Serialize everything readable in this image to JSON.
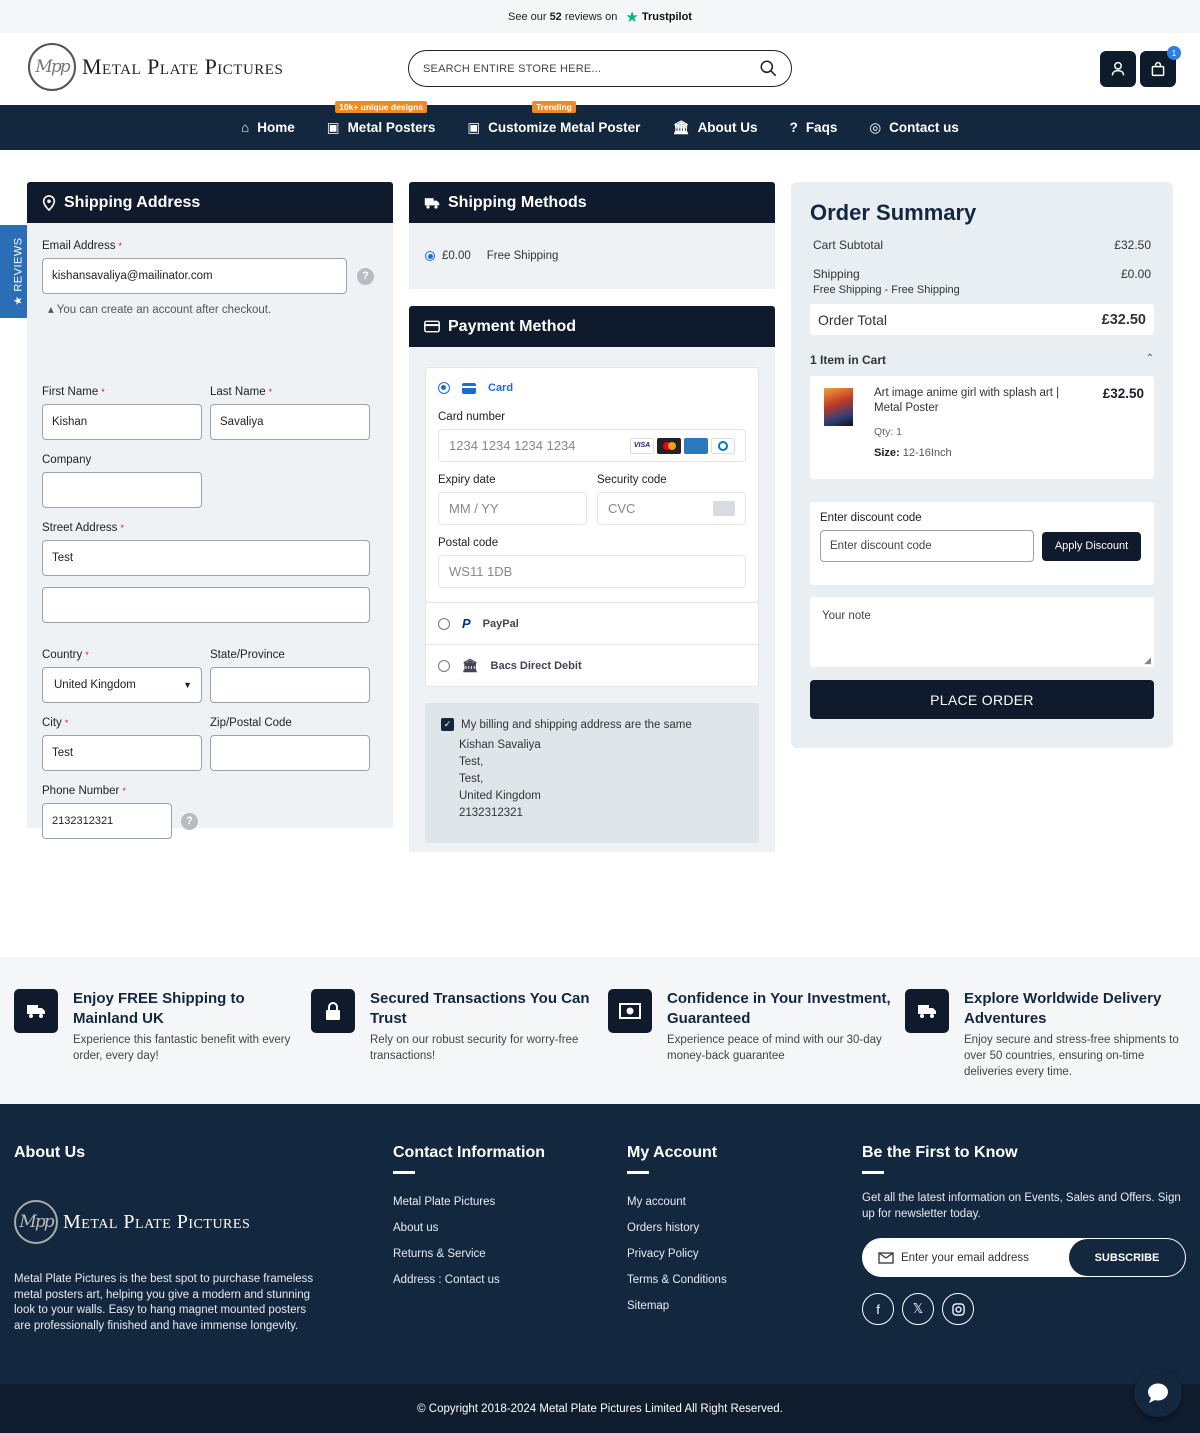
{
  "topbar": {
    "prefix": "See our",
    "count": "52",
    "suffix": "reviews on",
    "brand": "Trustpilot"
  },
  "header": {
    "logo_mark": "Mpp",
    "logo_text": "Metal Plate Pictures",
    "search_placeholder": "SEARCH ENTIRE STORE HERE...",
    "cart_count": "1"
  },
  "nav": [
    {
      "label": "Home",
      "icon": "home-icon"
    },
    {
      "label": "Metal Posters",
      "icon": "image-icon",
      "tag": "10k+ unique designs"
    },
    {
      "label": "Customize Metal Poster",
      "icon": "picture-icon",
      "tag": "Trending"
    },
    {
      "label": "About Us",
      "icon": "bank-icon"
    },
    {
      "label": "Faqs",
      "icon": "question-icon"
    },
    {
      "label": "Contact us",
      "icon": "lifebuoy-icon"
    }
  ],
  "reviews_tab": "★ REVIEWS",
  "shipping": {
    "title": "Shipping Address",
    "email_label": "Email Address",
    "email_value": "kishansavaliya@mailinator.com",
    "account_note": "You can create an account after checkout.",
    "first_name_label": "First Name",
    "first_name_value": "Kishan",
    "last_name_label": "Last Name",
    "last_name_value": "Savaliya",
    "company_label": "Company",
    "company_value": "",
    "street_label": "Street Address",
    "street_value": "Test",
    "street2_value": "",
    "country_label": "Country",
    "country_value": "United Kingdom",
    "state_label": "State/Province",
    "state_value": "",
    "city_label": "City",
    "city_value": "Test",
    "zip_label": "Zip/Postal Code",
    "zip_value": "",
    "phone_label": "Phone Number",
    "phone_value": "2132312321",
    "required_mark": "*"
  },
  "methods": {
    "title": "Shipping Methods",
    "price": "£0.00",
    "name": "Free Shipping"
  },
  "payment": {
    "title": "Payment Method",
    "card_label": "Card",
    "card_number_label": "Card number",
    "card_number_placeholder": "1234 1234 1234 1234",
    "visa_text": "VISA",
    "expiry_label": "Expiry date",
    "expiry_placeholder": "MM / YY",
    "cvc_label": "Security code",
    "cvc_placeholder": "CVC",
    "postal_label": "Postal code",
    "postal_value": "WS11 1DB",
    "paypal_label": "PayPal",
    "bacs_label": "Bacs Direct Debit",
    "billing_same_label": "My billing and shipping address are the same",
    "billing_lines": [
      "Kishan Savaliya",
      "Test,",
      "Test,",
      "United Kingdom",
      "2132312321"
    ]
  },
  "summary": {
    "title": "Order Summary",
    "subtotal_label": "Cart Subtotal",
    "subtotal_value": "£32.50",
    "shipping_label": "Shipping",
    "shipping_value": "£0.00",
    "shipping_sub": "Free Shipping - Free Shipping",
    "total_label": "Order Total",
    "total_value": "£32.50",
    "items_label": "1 Item in Cart",
    "item_name": "Art image anime girl with splash art | Metal Poster",
    "item_price": "£32.50",
    "item_qty": "Qty: 1",
    "item_size_label": "Size:",
    "item_size_value": "12-16Inch",
    "discount_label": "Enter discount code",
    "discount_placeholder": "Enter discount code",
    "discount_button": "Apply Discount",
    "note_placeholder": "Your note",
    "place_order": "PLACE ORDER"
  },
  "features": [
    {
      "title": "Enjoy FREE Shipping to Mainland UK",
      "text": "Experience this fantastic benefit with every order, every day!",
      "icon": "truck-icon"
    },
    {
      "title": "Secured Transactions You Can Trust",
      "text": "Rely on our robust security for worry-free transactions!",
      "icon": "lock-icon"
    },
    {
      "title": "Confidence in Your Investment, Guaranteed",
      "text": "Experience peace of mind with our 30-day money-back guarantee",
      "icon": "money-icon"
    },
    {
      "title": "Explore Worldwide Delivery Adventures",
      "text": "Enjoy secure and stress-free shipments to over 50 countries, ensuring on-time deliveries every time.",
      "icon": "truck-icon"
    }
  ],
  "footer": {
    "about_title": "About Us",
    "logo_mark": "Mpp",
    "logo_text": "Metal Plate Pictures",
    "about_text": "Metal Plate Pictures is the best spot to purchase frameless metal posters art, helping you give a modern and stunning look to your walls. Easy to hang magnet mounted posters are professionally finished and have immense longevity.",
    "contact_title": "Contact Information",
    "contact_company": "Metal Plate Pictures",
    "contact_links": [
      "About us",
      "Returns & Service"
    ],
    "contact_address_label": "Address :",
    "contact_address_link": "Contact us",
    "account_title": "My Account",
    "account_links": [
      "My account",
      "Orders history",
      "Privacy Policy",
      "Terms & Conditions",
      "Sitemap"
    ],
    "news_title": "Be the First to Know",
    "news_text": "Get all the latest information on Events, Sales and Offers. Sign up for newsletter today.",
    "news_placeholder": "Enter your email address",
    "subscribe": "SUBSCRIBE",
    "social_glyphs": {
      "facebook": "f",
      "x": "𝕏"
    },
    "copyright": "© Copyright 2018-2024 Metal Plate Pictures Limited All Right Reserved."
  }
}
